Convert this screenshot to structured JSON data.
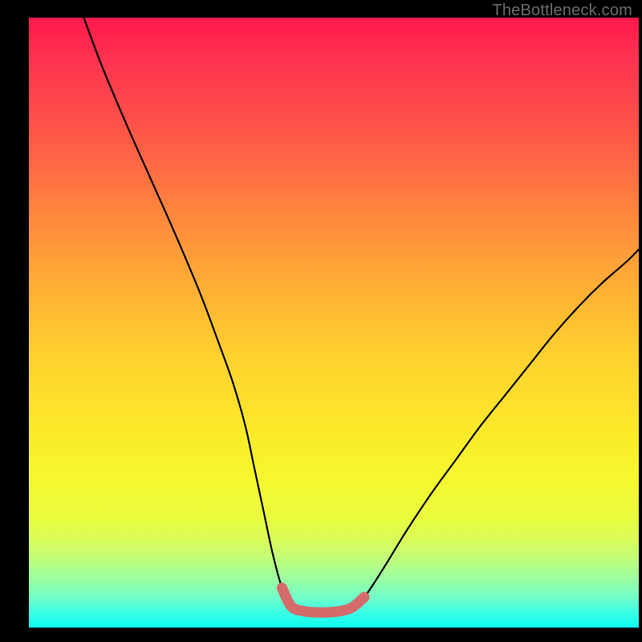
{
  "watermark": "TheBottleneck.com",
  "chart_data": {
    "type": "line",
    "title": "",
    "xlabel": "",
    "ylabel": "",
    "xlim": [
      0,
      100
    ],
    "ylim": [
      0,
      100
    ],
    "series": [
      {
        "name": "curve",
        "x": [
          9,
          12,
          16,
          20,
          24,
          28,
          31,
          33.5,
          35.5,
          37,
          38.5,
          40,
          41.5,
          43,
          45,
          47,
          49,
          51,
          53,
          55,
          58,
          62,
          66,
          70,
          74,
          78,
          82,
          86,
          90,
          94,
          98,
          100
        ],
        "y": [
          100,
          92,
          82.5,
          73.5,
          64.5,
          55,
          47,
          40,
          33,
          26,
          19,
          12,
          6.5,
          3.5,
          2.7,
          2.5,
          2.5,
          2.7,
          3.3,
          5,
          9.5,
          16,
          22,
          27.5,
          33,
          38,
          43,
          48,
          52.5,
          56.5,
          60,
          62
        ]
      },
      {
        "name": "highlight-segment",
        "x": [
          41.5,
          43,
          45,
          47,
          49,
          51,
          53,
          55
        ],
        "y": [
          6.5,
          3.5,
          2.7,
          2.5,
          2.5,
          2.7,
          3.3,
          5
        ]
      }
    ],
    "gradient_bands": [
      {
        "y": 100,
        "color": "#ff1a4e"
      },
      {
        "y": 56,
        "color": "#ffd22e"
      },
      {
        "y": 24,
        "color": "#f5f82f"
      },
      {
        "y": 0,
        "color": "#0cfff2"
      }
    ]
  }
}
